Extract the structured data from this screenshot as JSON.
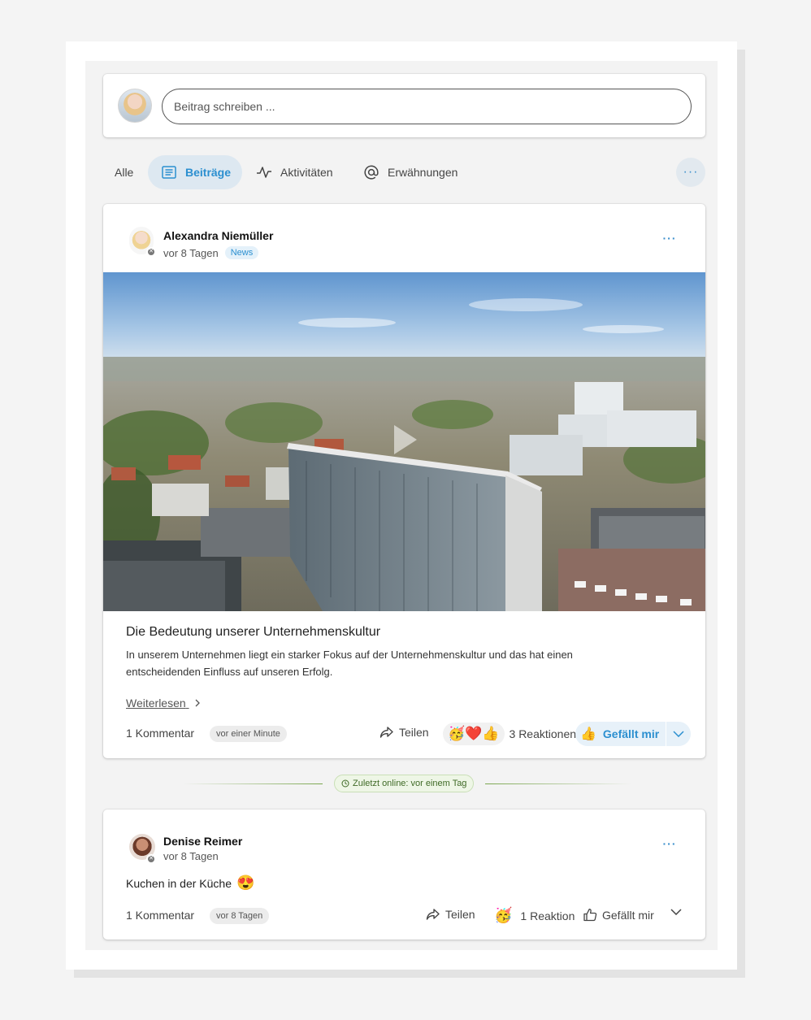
{
  "composer": {
    "placeholder": "Beitrag schreiben ..."
  },
  "tabs": [
    {
      "label": "Alle",
      "icon": "none",
      "active": false
    },
    {
      "label": "Beiträge",
      "icon": "document-icon",
      "active": true
    },
    {
      "label": "Aktivitäten",
      "icon": "activity-icon",
      "active": false
    },
    {
      "label": "Erwähnungen",
      "icon": "at-icon",
      "active": false
    }
  ],
  "tabs_more": "···",
  "posts": [
    {
      "author": "Alexandra Niemüller",
      "time": "vor 8 Tagen",
      "badge": "News",
      "more": "···",
      "title": "Die Bedeutung unserer Unternehmenskultur",
      "text": "In unserem Unternehmen liegt ein starker Fokus auf der Unternehmenskultur und das hat einen entscheidenden Einfluss auf unseren Erfolg.",
      "read_more": "Weiterlesen",
      "comments": "1 Kommentar",
      "comment_time": "vor einer Minute",
      "share": "Teilen",
      "reaction_emojis": "🥳❤️👍",
      "reactions": "3 Reaktionen",
      "like_emoji": "👍",
      "like": "Gefällt mir"
    },
    {
      "author": "Denise Reimer",
      "time": "vor 8 Tagen",
      "more": "···",
      "text": "Kuchen in der Küche",
      "text_emoji": "😍",
      "comments": "1 Kommentar",
      "comment_time": "vor 8 Tagen",
      "share": "Teilen",
      "reaction_emoji": "🥳",
      "reactions": "1 Reaktion",
      "like": "Gefällt mir"
    }
  ],
  "divider": {
    "label": "Zuletzt online: vor einem Tag"
  },
  "colors": {
    "accent": "#2b8fd0",
    "active_tab_bg": "#dde8f1",
    "online_green": "#3f6a26"
  }
}
